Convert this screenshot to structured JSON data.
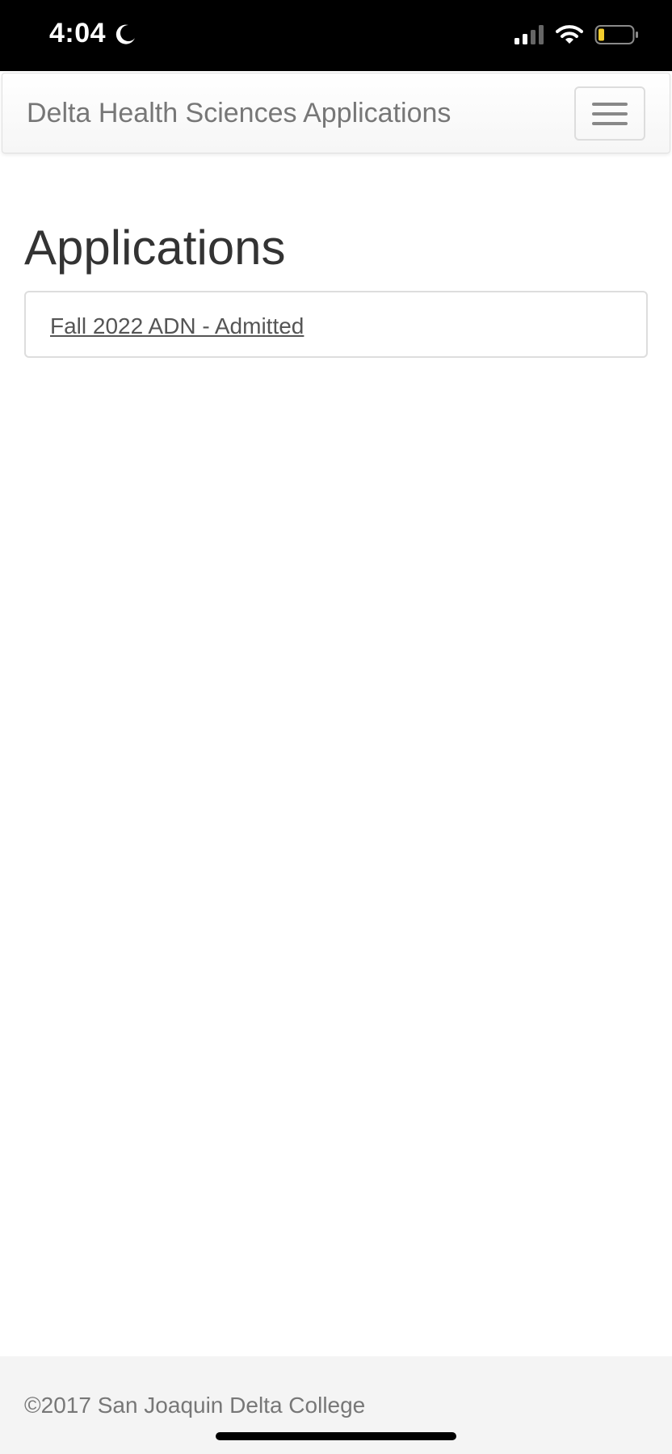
{
  "status_bar": {
    "time": "4:04",
    "icons": [
      "moon-icon",
      "signal-icon",
      "wifi-icon",
      "battery-icon"
    ],
    "battery_color": "#f2cc2c"
  },
  "navbar": {
    "brand": "Delta Health Sciences Applications",
    "menu_icon": "hamburger-icon"
  },
  "main": {
    "title": "Applications",
    "applications": [
      {
        "label": "Fall 2022 ADN - Admitted"
      }
    ]
  },
  "footer": {
    "copyright": "©2017 San Joaquin Delta College"
  },
  "colors": {
    "status_bar_bg": "#000000",
    "navbar_bg": "#f8f8f8",
    "footer_bg": "#f4f4f4",
    "brand_text": "#777777",
    "title_text": "#333333"
  }
}
